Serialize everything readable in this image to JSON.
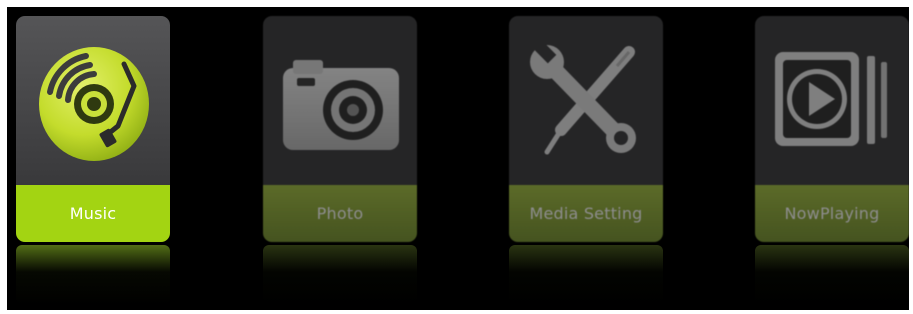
{
  "menu": {
    "items": [
      {
        "label": "Music",
        "icon": "music-disc-icon",
        "selected": true
      },
      {
        "label": "Photo",
        "icon": "camera-icon",
        "selected": false
      },
      {
        "label": "Media Setting",
        "icon": "wrench-screwdriver-icon",
        "selected": false
      },
      {
        "label": "NowPlaying",
        "icon": "play-icon",
        "selected": false
      }
    ]
  },
  "colors": {
    "background": "#000000",
    "tile": "#444446",
    "accent_selected": "#a3d412",
    "accent_unselected": "#8ba342",
    "label_text": "#ffffff"
  }
}
